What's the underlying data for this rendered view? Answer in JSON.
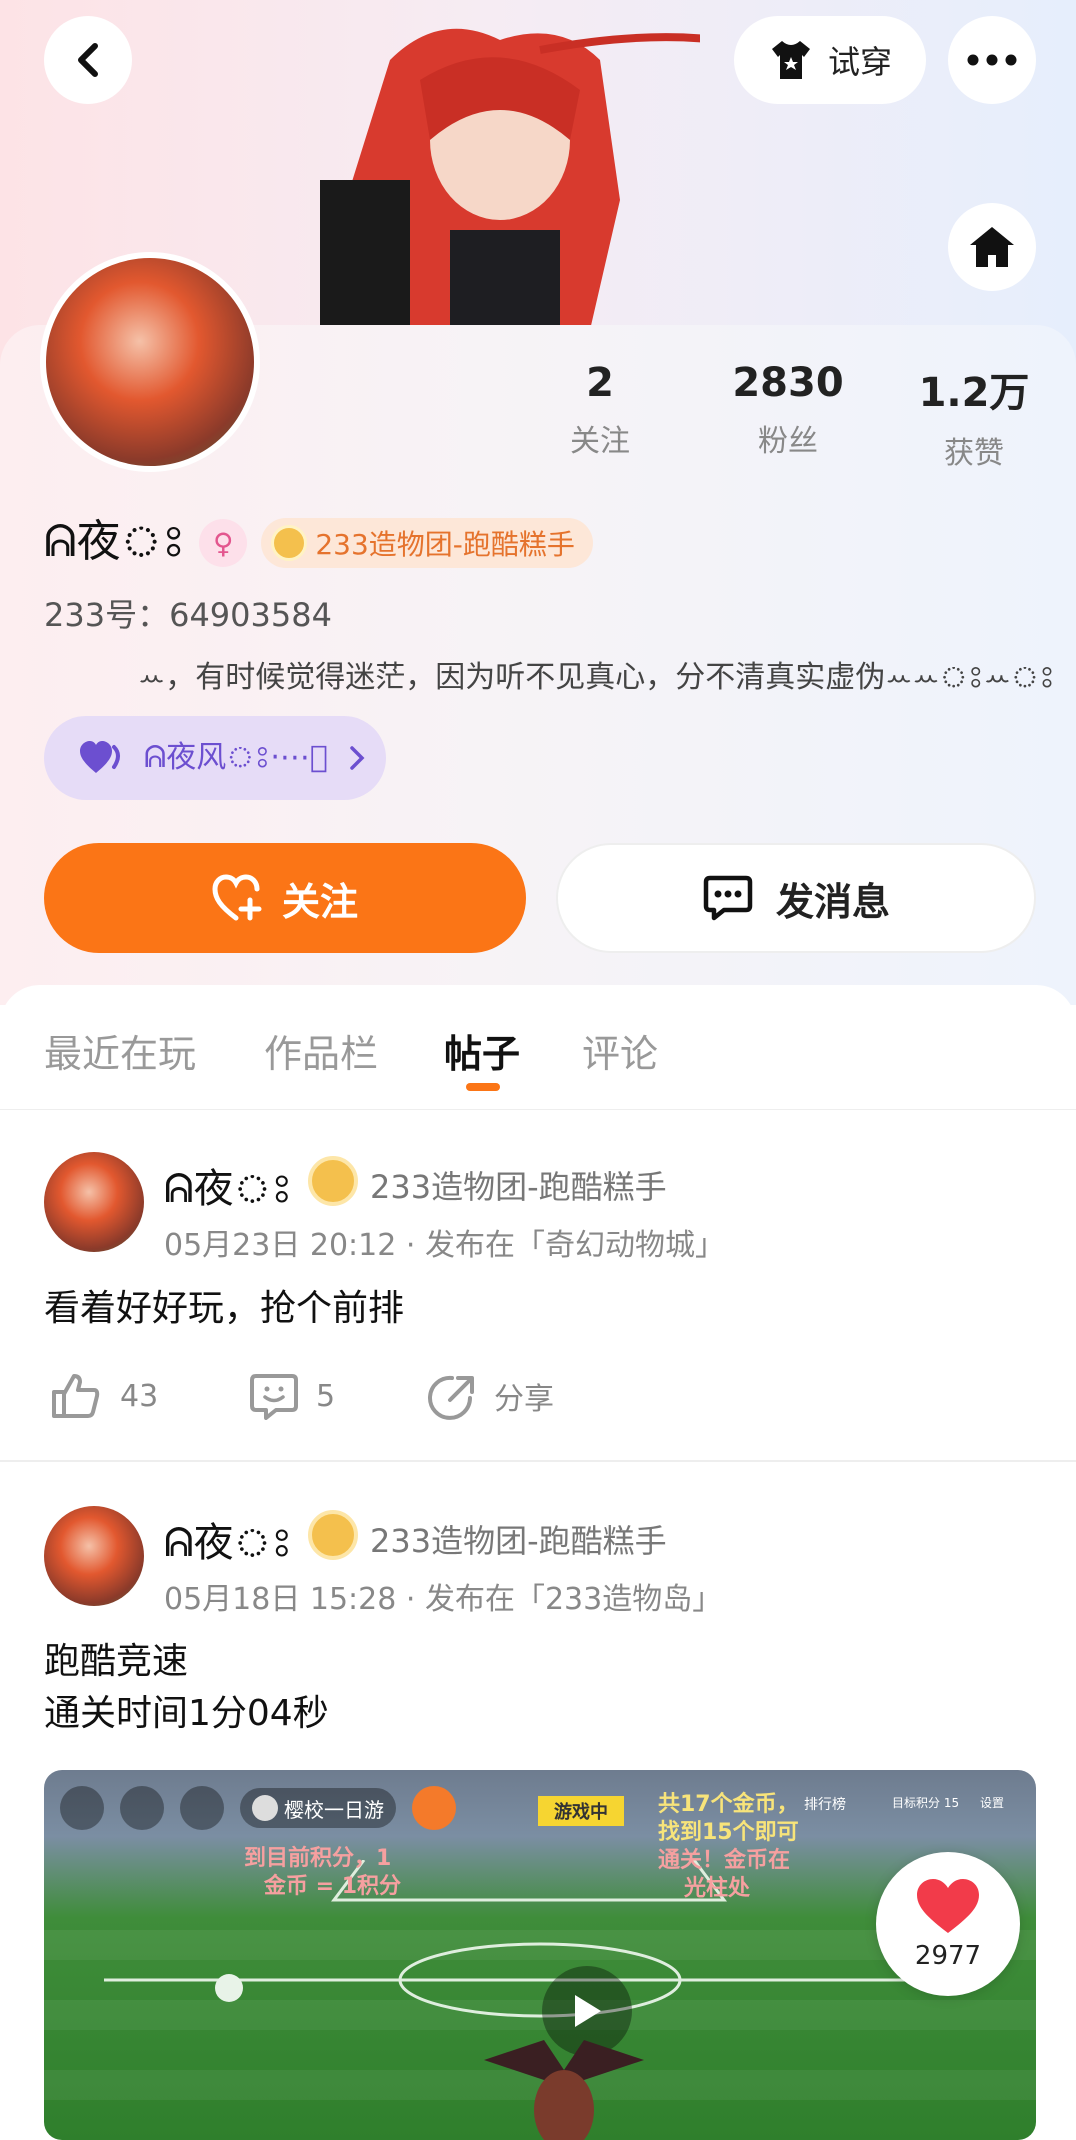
{
  "header": {
    "tryon_label": "试穿"
  },
  "profile": {
    "stats": [
      {
        "value": "2",
        "label": "关注"
      },
      {
        "value": "2830",
        "label": "粉丝"
      },
      {
        "value": "1.2万",
        "label": "获赞"
      }
    ],
    "nickname": "ᕱ夜ঃ",
    "gender_icon": "female-icon",
    "team": "233造物团-跑酷糕手",
    "uid": "233号：64903584",
    "bio": "ꕀ，有时候觉得迷茫，因为听不见真心，分不清真实虚伪ꕀꕀঃꕀঃ",
    "cp_name": "ᕱ夜风ঃ·⋯ঃ",
    "follow_label": "关注",
    "message_label": "发消息"
  },
  "tabs": {
    "items": [
      {
        "label": "最近在玩"
      },
      {
        "label": "作品栏"
      },
      {
        "label": "帖子"
      },
      {
        "label": "评论"
      }
    ],
    "active": "帖子"
  },
  "posts": [
    {
      "author": "ᕱ夜ঃ",
      "team": "233造物团-跑酷糕手",
      "meta": "05月23日 20:12 · 发布在「奇幻动物城」",
      "text": "看着好好玩，抢个前排",
      "likes": "43",
      "comments": "5",
      "share_label": "分享"
    },
    {
      "author": "ᕱ夜ঃ",
      "team": "233造物团-跑酷糕手",
      "meta": "05月18日 15:28 · 发布在「233造物岛」",
      "text_line1": "跑酷竞速",
      "text_line2": "通关时间1分04秒",
      "media": {
        "player_chip": "樱校一日游",
        "playing_tag": "游戏中",
        "hud_left_1": "到目前积分，1",
        "hud_left_2": "金币 = 1积分",
        "hud_right_1": "共17个金币，",
        "hud_right_2": "找到15个即可",
        "hud_right_3": "通关！金币在",
        "hud_right_4": "光柱处",
        "leaderboard": "排行榜",
        "target_score": "目标积分 15",
        "settings": "设置"
      },
      "like_count": "2977"
    }
  ],
  "colors": {
    "accent": "#fb7516",
    "cp_purple": "#6c4fd0",
    "like_red": "#f23b4a"
  }
}
